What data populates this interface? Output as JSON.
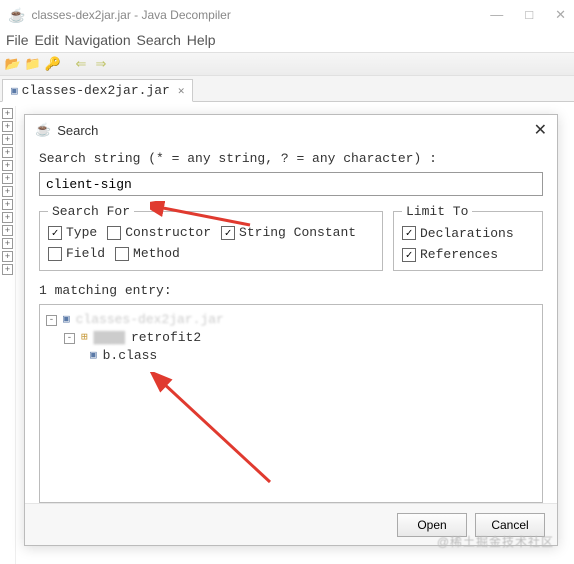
{
  "window": {
    "title": "classes-dex2jar.jar - Java Decompiler",
    "min_tip": "—",
    "max_tip": "□",
    "close_tip": "✕"
  },
  "menubar": {
    "file": "File",
    "edit": "Edit",
    "navigation": "Navigation",
    "search": "Search",
    "help": "Help"
  },
  "toolbar_icons": {
    "open": "📂",
    "save": "📁",
    "key": "🔑",
    "back": "⇐",
    "fwd": "⇒"
  },
  "tab": {
    "label": "classes-dex2jar.jar",
    "close": "✕"
  },
  "dialog": {
    "title": "Search",
    "close": "✕",
    "prompt": "Search string (* = any string, ? = any character) :",
    "value": "client-sign",
    "search_for_legend": "Search For",
    "limit_to_legend": "Limit To",
    "opts": {
      "type": "Type",
      "constructor": "Constructor",
      "string_constant": "String Constant",
      "field": "Field",
      "method": "Method",
      "declarations": "Declarations",
      "references": "References"
    },
    "checked": {
      "type": true,
      "constructor": false,
      "string_constant": true,
      "field": false,
      "method": false,
      "declarations": true,
      "references": true
    },
    "match_label": "1 matching entry:",
    "results": {
      "root": "classes-dex2jar.jar",
      "pkg": "retrofit2",
      "leaf": "b.class"
    },
    "ok": "Open",
    "cancel": "Cancel"
  },
  "watermark": "@稀土掘金技术社区"
}
